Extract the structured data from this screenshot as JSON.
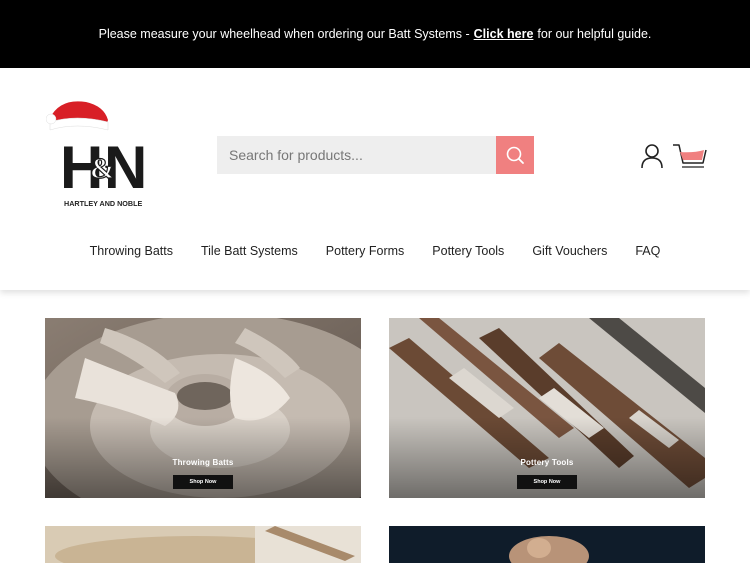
{
  "announcement": {
    "text_before": "Please measure your wheelhead when ordering our Batt Systems -",
    "link": "Click here",
    "text_after": "for our helpful guide."
  },
  "logo": {
    "initials": "H&N",
    "name": "HARTLEY AND NOBLE"
  },
  "search": {
    "placeholder": "Search for products..."
  },
  "icons": {
    "search": "search-icon",
    "account": "account-icon",
    "cart": "cart-icon"
  },
  "nav": {
    "items": [
      "Throwing Batts",
      "Tile Batt Systems",
      "Pottery Forms",
      "Pottery Tools",
      "Gift Vouchers",
      "FAQ"
    ]
  },
  "tiles": [
    {
      "label": "Throwing Batts",
      "cta": "Shop Now"
    },
    {
      "label": "Pottery Tools",
      "cta": "Shop Now"
    }
  ],
  "colors": {
    "announcement_bg": "#000000",
    "search_button": "#f08080",
    "search_field": "#eeeeee"
  }
}
